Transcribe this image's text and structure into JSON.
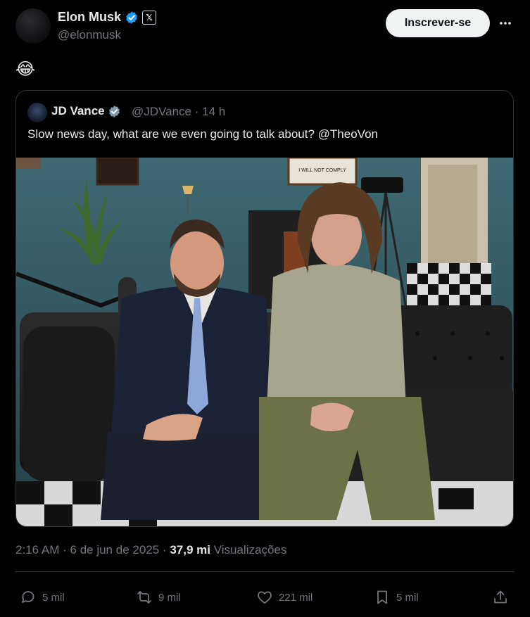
{
  "author": {
    "name": "Elon Musk",
    "handle": "@elonmusk",
    "affiliation_badge": "𝕏"
  },
  "header": {
    "subscribe_label": "Inscrever-se",
    "more_icon": "more-icon"
  },
  "tweet": {
    "text": "😂"
  },
  "quoted": {
    "name": "JD Vance",
    "handle": "@JDVance",
    "separator": "·",
    "time": "14 h",
    "text": "Slow news day, what are we even going to talk about? @TheoVon",
    "photo_sign": "I WILL NOT COMPLY"
  },
  "timeline": {
    "time": "2:16 AM",
    "sep": "·",
    "date": "6 de jun de 2025",
    "views_value": "37,9 mi",
    "views_label": "Visualizações"
  },
  "actions": {
    "replies": "5 mil",
    "reposts": "9 mil",
    "likes": "221 mil",
    "bookmarks": "5 mil"
  },
  "colors": {
    "background": "#000000",
    "text": "#e7e9ea",
    "muted": "#71767b",
    "border": "#2f3336",
    "verified": "#1d9bf0"
  }
}
